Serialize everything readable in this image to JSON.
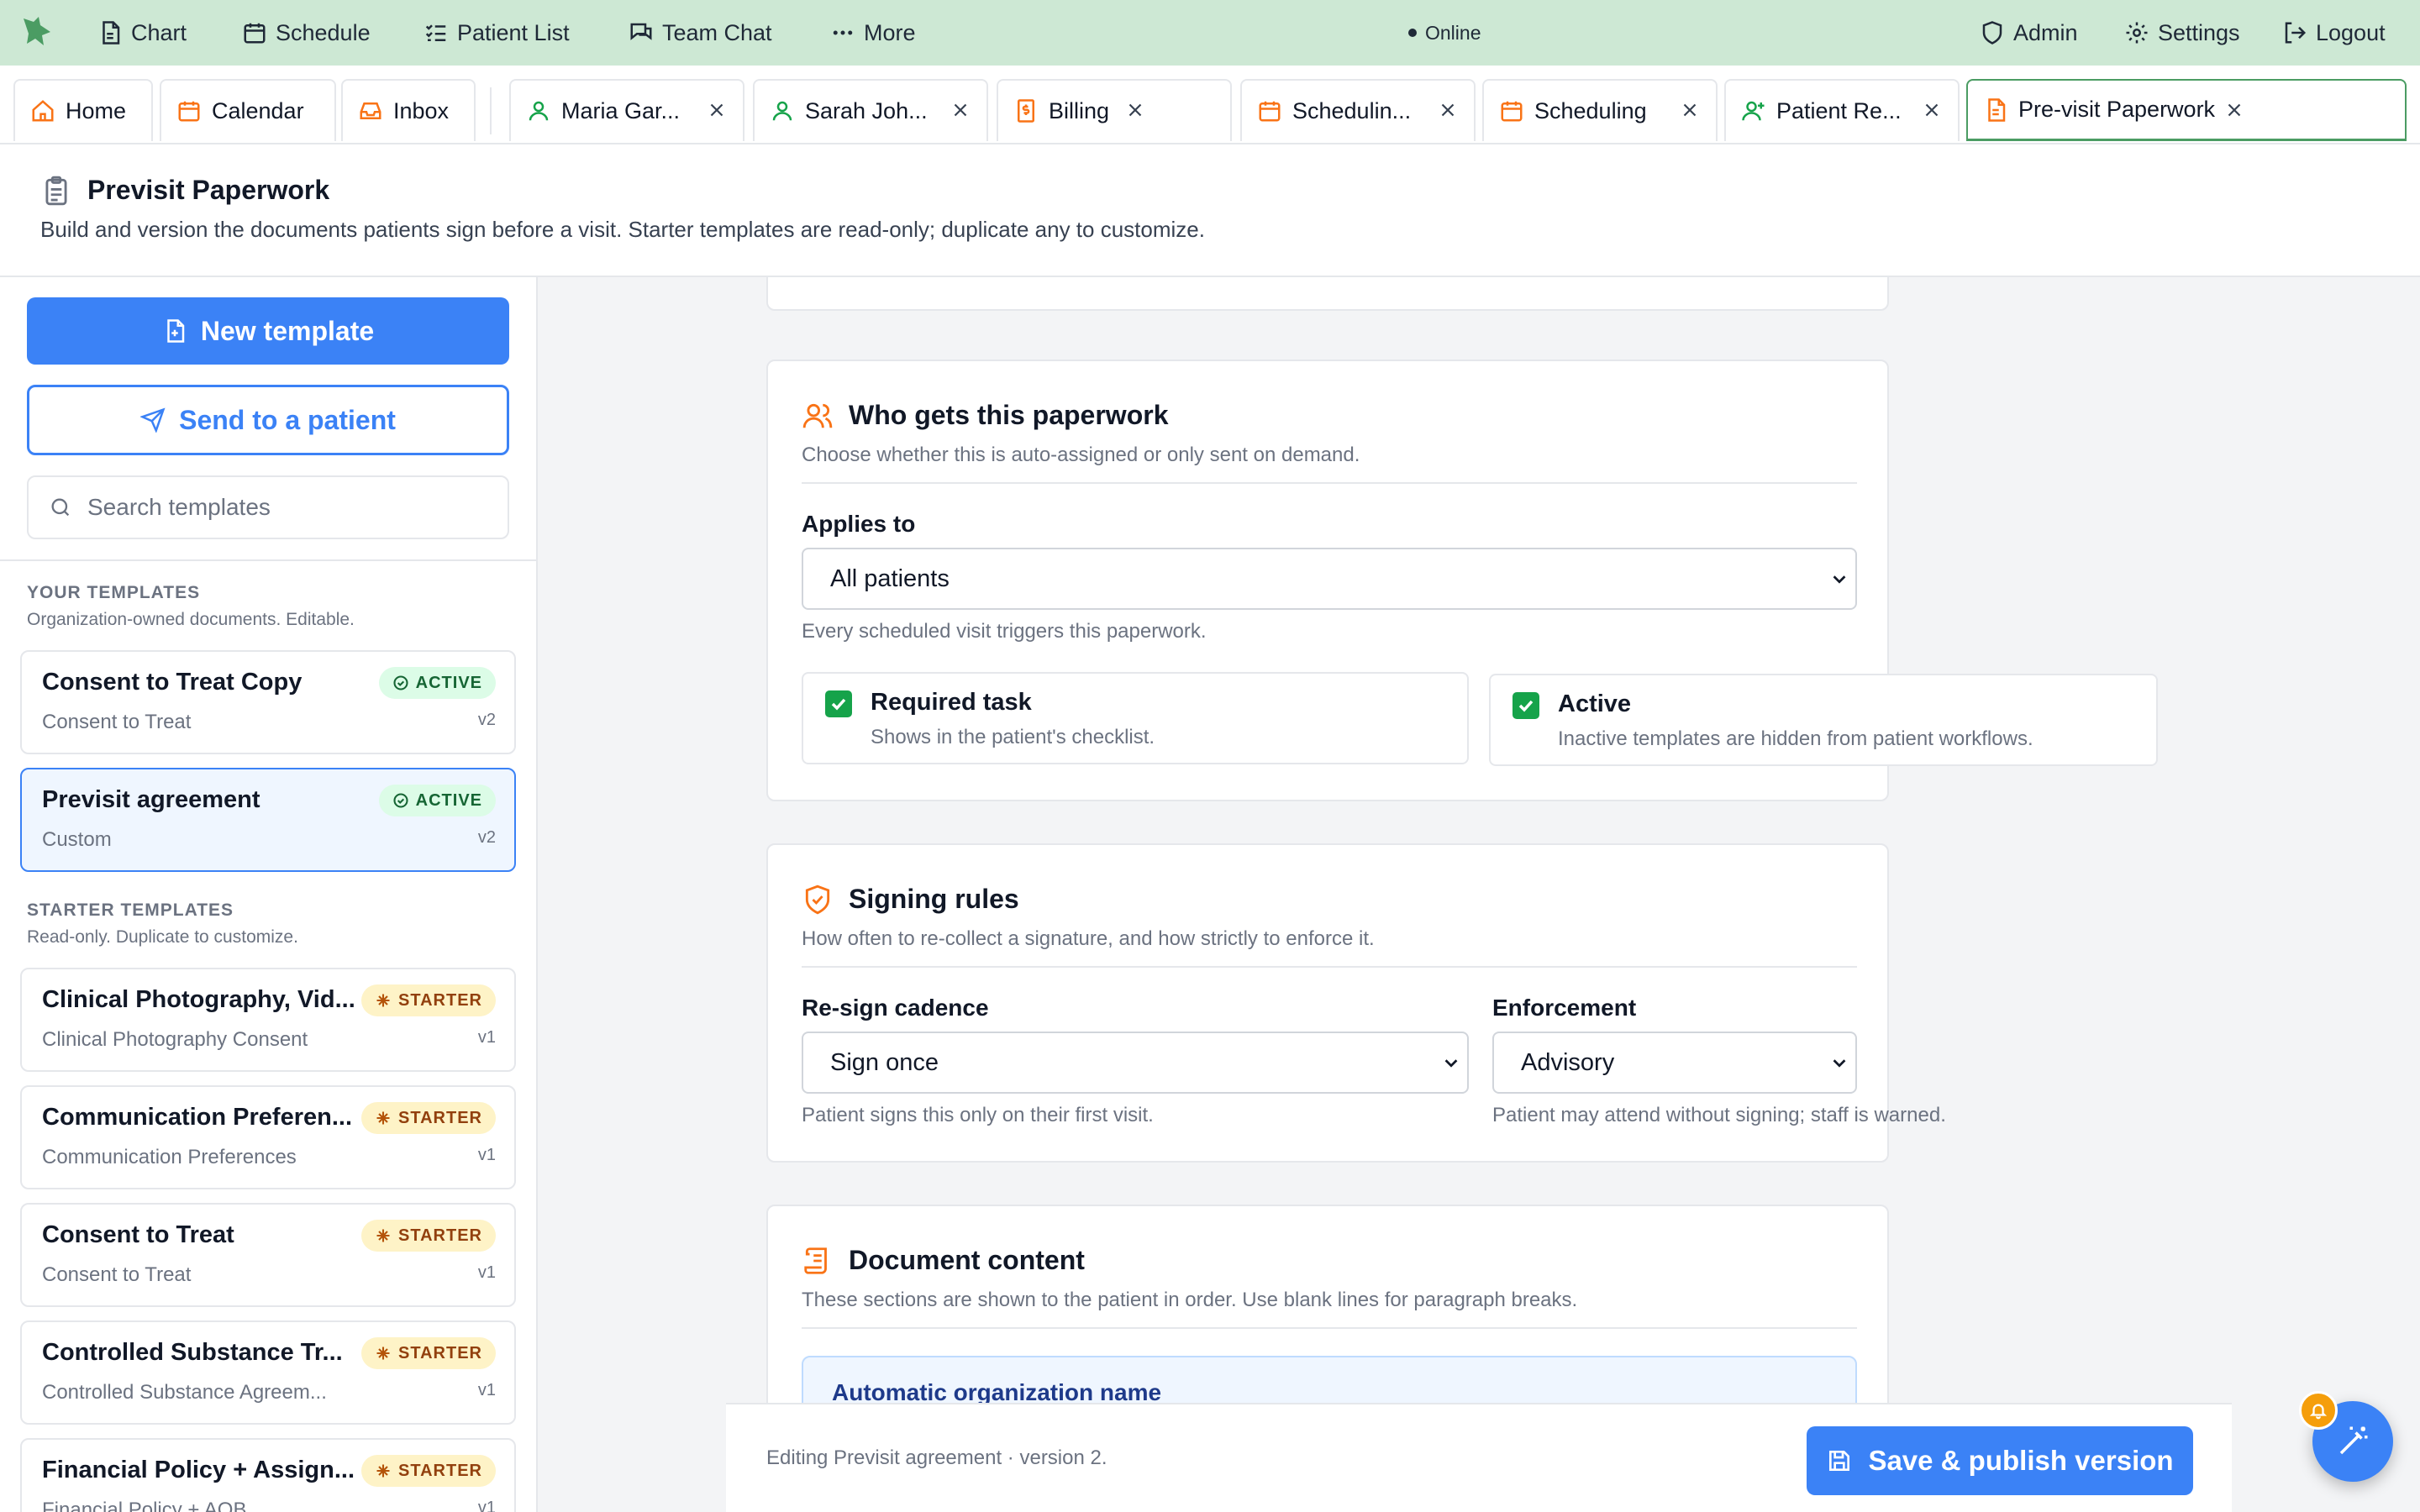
{
  "colors": {
    "topnav_bg": "#cde8d4",
    "primary": "#3b82f6",
    "accent_orange": "#f97316",
    "active_tab_border": "#4b9c63",
    "success": "#16a34a"
  },
  "topnav": {
    "items": [
      {
        "label": "Chart",
        "icon": "file-chart-icon"
      },
      {
        "label": "Schedule",
        "icon": "calendar-icon"
      },
      {
        "label": "Patient List",
        "icon": "list-check-icon"
      },
      {
        "label": "Team Chat",
        "icon": "chat-icon"
      },
      {
        "label": "More",
        "icon": "more-dots-icon"
      }
    ],
    "status": "Online",
    "right_items": [
      {
        "label": "Admin",
        "icon": "shield-icon"
      },
      {
        "label": "Settings",
        "icon": "gear-icon"
      },
      {
        "label": "Logout",
        "icon": "logout-icon"
      }
    ]
  },
  "tabs": [
    {
      "label": "Home",
      "icon": "home-icon"
    },
    {
      "label": "Calendar",
      "icon": "calendar-icon"
    },
    {
      "label": "Inbox",
      "icon": "inbox-icon"
    },
    {
      "label": "Maria Gar...",
      "icon": "user-icon"
    },
    {
      "label": "Sarah Joh...",
      "icon": "user-icon"
    },
    {
      "label": "Billing",
      "icon": "billing-icon"
    },
    {
      "label": "Schedulin...",
      "icon": "calendar-icon"
    },
    {
      "label": "Scheduling",
      "icon": "calendar-icon"
    },
    {
      "label": "Patient Re...",
      "icon": "user-plus-icon"
    },
    {
      "label": "Pre-visit Paperwork",
      "icon": "document-icon",
      "active": true
    }
  ],
  "page": {
    "title": "Previsit Paperwork",
    "subtitle": "Build and version the documents patients sign before a visit. Starter templates are read-only; duplicate any to customize."
  },
  "sidebar": {
    "new_template_label": "New template",
    "send_label": "Send to a patient",
    "search_placeholder": "Search templates",
    "your_templates": {
      "title": "YOUR TEMPLATES",
      "subtitle": "Organization-owned documents. Editable.",
      "items": [
        {
          "title": "Consent to Treat Copy",
          "subtitle": "Consent to Treat",
          "badge": "ACTIVE",
          "version": "v2"
        },
        {
          "title": "Previsit agreement",
          "subtitle": "Custom",
          "badge": "ACTIVE",
          "version": "v2",
          "selected": true
        }
      ]
    },
    "starter_templates": {
      "title": "STARTER TEMPLATES",
      "subtitle": "Read-only. Duplicate to customize.",
      "items": [
        {
          "title": "Clinical Photography, Vid...",
          "subtitle": "Clinical Photography Consent",
          "badge": "STARTER",
          "version": "v1"
        },
        {
          "title": "Communication Preferen...",
          "subtitle": "Communication Preferences",
          "badge": "STARTER",
          "version": "v1"
        },
        {
          "title": "Consent to Treat",
          "subtitle": "Consent to Treat",
          "badge": "STARTER",
          "version": "v1"
        },
        {
          "title": "Controlled Substance Tr...",
          "subtitle": "Controlled Substance Agreem...",
          "badge": "STARTER",
          "version": "v1"
        },
        {
          "title": "Financial Policy + Assign...",
          "subtitle": "Financial Policy + AOB",
          "badge": "STARTER",
          "version": "v1"
        }
      ]
    }
  },
  "who_gets": {
    "title": "Who gets this paperwork",
    "subtitle": "Choose whether this is auto-assigned or only sent on demand.",
    "applies_to_label": "Applies to",
    "applies_to_value": "All patients",
    "applies_to_help": "Every scheduled visit triggers this paperwork.",
    "required": {
      "label": "Required task",
      "help": "Shows in the patient's checklist.",
      "checked": true
    },
    "active": {
      "label": "Active",
      "help": "Inactive templates are hidden from patient workflows.",
      "checked": true
    }
  },
  "signing_rules": {
    "title": "Signing rules",
    "subtitle": "How often to re-collect a signature, and how strictly to enforce it.",
    "cadence_label": "Re-sign cadence",
    "cadence_value": "Sign once",
    "cadence_help": "Patient signs this only on their first visit.",
    "enforcement_label": "Enforcement",
    "enforcement_value": "Advisory",
    "enforcement_help": "Patient may attend without signing; staff is warned."
  },
  "document_content": {
    "title": "Document content",
    "subtitle": "These sections are shown to the patient in order. Use blank lines for paragraph breaks.",
    "first_section_title": "Automatic organization name"
  },
  "footer": {
    "status": "Editing Previsit agreement · version 2.",
    "save_label": "Save & publish version"
  }
}
